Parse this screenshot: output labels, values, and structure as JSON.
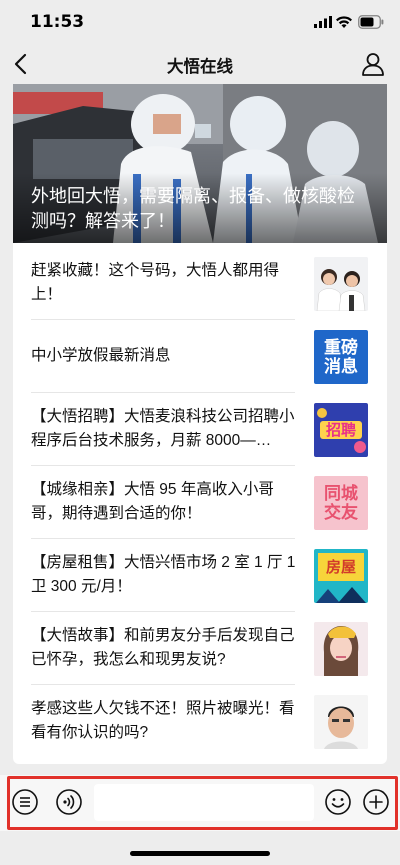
{
  "status_bar": {
    "time": "11:53"
  },
  "nav": {
    "title": "大悟在线"
  },
  "hero": {
    "title": "外地回大悟，需要隔离、报备、做核酸检测吗？解答来了！"
  },
  "articles": [
    {
      "title": "赶紧收藏！这个号码，大悟人都用得上！",
      "thumb_text": ""
    },
    {
      "title": "中小学放假最新消息",
      "thumb_text": "重磅消息"
    },
    {
      "title": "【大悟招聘】大悟麦浪科技公司招聘小程序后台技术服务，月薪 8000—…",
      "thumb_text": "招聘"
    },
    {
      "title": "【城缘相亲】大悟 95 年高收入小哥哥，期待遇到合适的你！",
      "thumb_text": "同城交友"
    },
    {
      "title": "【房屋租售】大悟兴悟市场 2 室 1 厅 1 卫 300 元/月！",
      "thumb_text": "房屋"
    },
    {
      "title": "【大悟故事】和前男友分手后发现自己已怀孕，我怎么和现男友说?",
      "thumb_text": ""
    },
    {
      "title": "孝感这些人欠钱不还！照片被曝光！看看有你认识的吗?",
      "thumb_text": ""
    }
  ],
  "input_bar": {
    "value": "",
    "placeholder": ""
  },
  "colors": {
    "highlight": "#e1312a",
    "urgent_thumb": "#1f67c9",
    "recruit_thumb": "#2f3fae",
    "dating_thumb": "#ef7f97",
    "house_thumb": "#21b6c7"
  }
}
